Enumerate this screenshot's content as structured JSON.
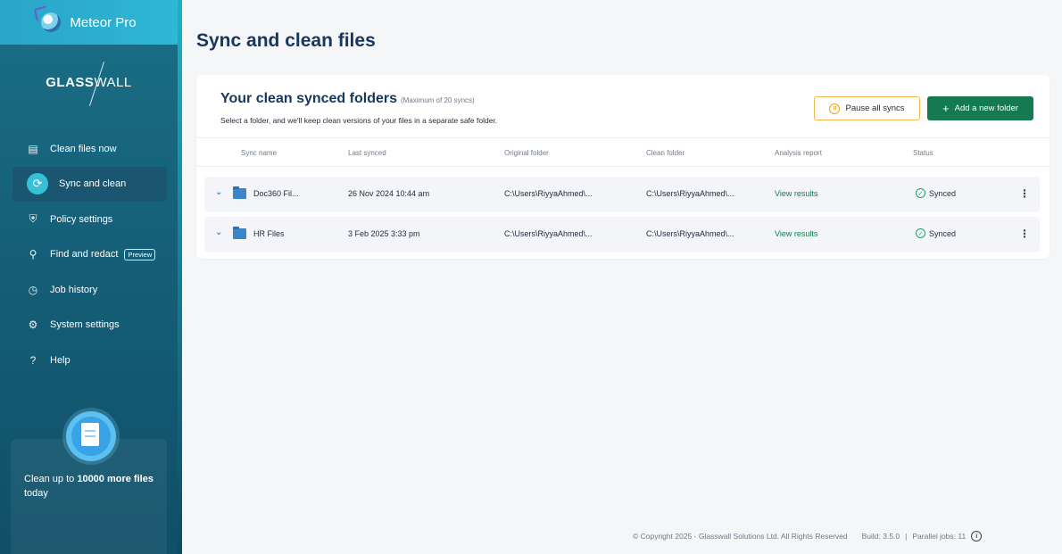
{
  "app": {
    "name": "Meteor Pro",
    "brand_bold": "GLASS",
    "brand_light": "WALL"
  },
  "sidebar": {
    "items": [
      {
        "label": "Clean files now",
        "icon": "clean-files-icon"
      },
      {
        "label": "Sync and clean",
        "icon": "sync-icon",
        "active": true
      },
      {
        "label": "Policy settings",
        "icon": "shield-icon"
      },
      {
        "label": "Find and redact",
        "icon": "find-redact-icon",
        "tag": "Preview"
      },
      {
        "label": "Job history",
        "icon": "clock-icon"
      },
      {
        "label": "System settings",
        "icon": "gear-icon"
      },
      {
        "label": "Help",
        "icon": "help-icon"
      }
    ],
    "promo": {
      "prefix": "Clean up to ",
      "bold": "10000 more files",
      "suffix": " today"
    }
  },
  "main": {
    "title": "Sync and clean files",
    "card": {
      "title": "Your clean synced folders",
      "title_note": "(Maximum of 20 syncs)",
      "subtitle": "Select a folder, and we'll keep clean versions of your files in a separate safe folder.",
      "pause_label": "Pause all syncs",
      "add_label": "Add a new folder",
      "columns": [
        "Sync name",
        "Last synced",
        "Original folder",
        "Clean folder",
        "Analysis report",
        "Status"
      ],
      "rows": [
        {
          "name": "Doc360 Fil...",
          "last_synced": "26 Nov 2024 10:44 am",
          "original": "C:\\Users\\RiyyaAhmed\\...",
          "clean": "C:\\Users\\RiyyaAhmed\\...",
          "report": "View results",
          "status": "Synced"
        },
        {
          "name": "HR Files",
          "last_synced": "3 Feb 2025 3:33 pm",
          "original": "C:\\Users\\RiyyaAhmed\\...",
          "clean": "C:\\Users\\RiyyaAhmed\\...",
          "report": "View results",
          "status": "Synced"
        }
      ]
    }
  },
  "footer": {
    "copyright": "© Copyright 2025 - Glasswall Solutions Ltd. All Rights Reserved",
    "build": "Build: 3.5.0",
    "separator": "|",
    "jobs": "Parallel jobs: 11"
  },
  "colors": {
    "accent_green": "#157a4f",
    "pause_border": "#f0b84a",
    "sidebar": "#155f78",
    "title": "#17375e"
  }
}
